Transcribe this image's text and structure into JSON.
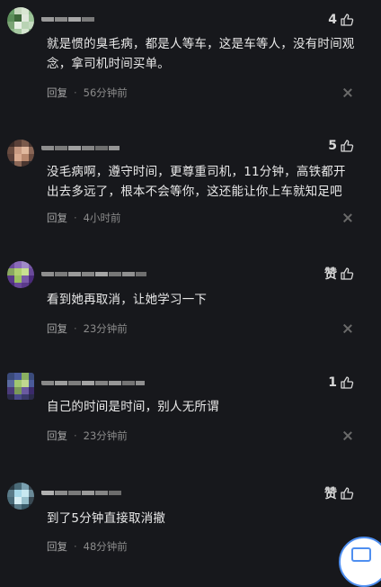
{
  "colors": {
    "background": "#17181c",
    "text": "#e9e9e9",
    "meta": "#8b8b8b",
    "accent": "#4f8ff0"
  },
  "comments": [
    {
      "text": "就是惯的臭毛病，都是人等车，这是车等人，没有时间观念，拿司机时间买单。",
      "reply_label": "回复",
      "separator": "·",
      "time": "56分钟前",
      "likes": "4"
    },
    {
      "text": "没毛病啊，遵守时间，更尊重司机，11分钟，高铁都开出去多远了，根本不会等你，这还能让你上车就知足吧",
      "reply_label": "回复",
      "separator": "·",
      "time": "4小时前",
      "likes": "5"
    },
    {
      "text": "看到她再取消，让她学习一下",
      "reply_label": "回复",
      "separator": "·",
      "time": "23分钟前",
      "likes": "赞"
    },
    {
      "text": "自己的时间是时间，别人无所谓",
      "reply_label": "回复",
      "separator": "·",
      "time": "23分钟前",
      "likes": "1"
    },
    {
      "text": "到了5分钟直接取消撤",
      "reply_label": "回复",
      "separator": "·",
      "time": "48分钟前",
      "likes": "赞"
    }
  ],
  "icons": {
    "like": "thumbs-up-icon",
    "close": "close-icon",
    "avatar": "pixelated-avatar"
  }
}
